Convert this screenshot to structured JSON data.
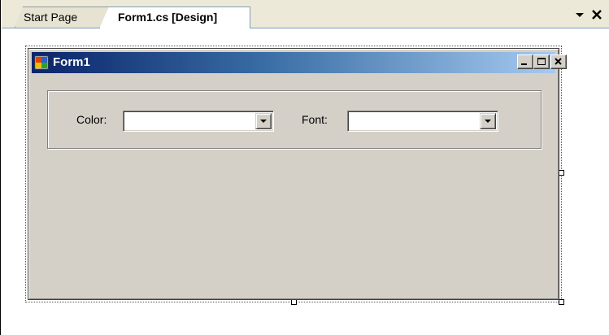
{
  "tabs": [
    {
      "label": "Start Page",
      "active": false
    },
    {
      "label": "Form1.cs [Design]",
      "active": true
    }
  ],
  "tabstrip": {
    "dropdown_icon": "triangle-down-icon",
    "close_icon": "close-icon"
  },
  "form": {
    "title": "Form1",
    "icon": "form-app-icon",
    "caption_buttons": [
      "minimize",
      "maximize",
      "close"
    ],
    "group": {
      "color_label": "Color:",
      "color_value": "",
      "font_label": "Font:",
      "font_value": ""
    }
  },
  "colors": {
    "title_gradient_start": "#0a246a",
    "title_gradient_end": "#a6caf0",
    "form_background": "#d4d0c8"
  }
}
